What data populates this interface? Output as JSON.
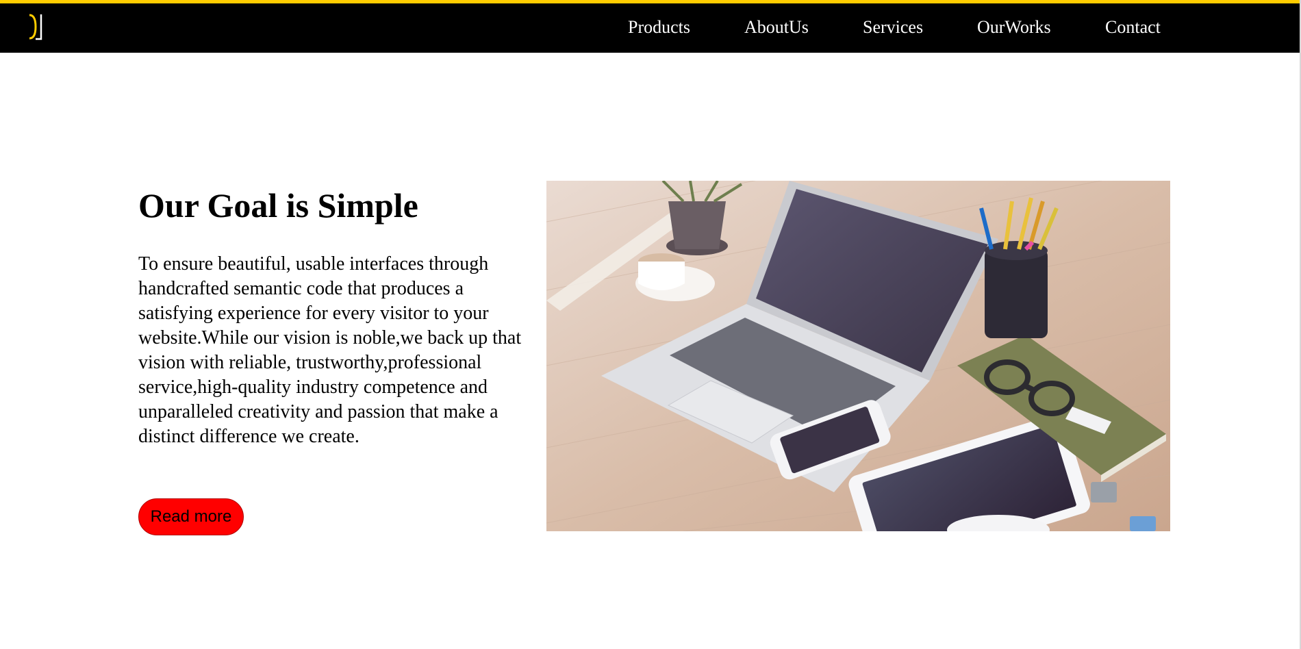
{
  "nav": {
    "items": [
      {
        "label": "Products"
      },
      {
        "label": "AboutUs"
      },
      {
        "label": "Services"
      },
      {
        "label": "OurWorks"
      },
      {
        "label": "Contact"
      }
    ]
  },
  "hero": {
    "title": "Our Goal is Simple",
    "description": "To ensure beautiful, usable interfaces through handcrafted semantic code that produces a satisfying experience for every visitor to your website.While our vision is noble,we back up that vision with reliable, trustworthy,professional service,high-quality industry competence and unparalleled creativity and passion that make a distinct difference we create.",
    "read_more_label": "Read more",
    "image_icon": "desk-laptop-photo"
  },
  "colors": {
    "topbar_bg": "#000000",
    "topbar_accent": "#ffcc00",
    "button_bg": "#ff0000"
  }
}
